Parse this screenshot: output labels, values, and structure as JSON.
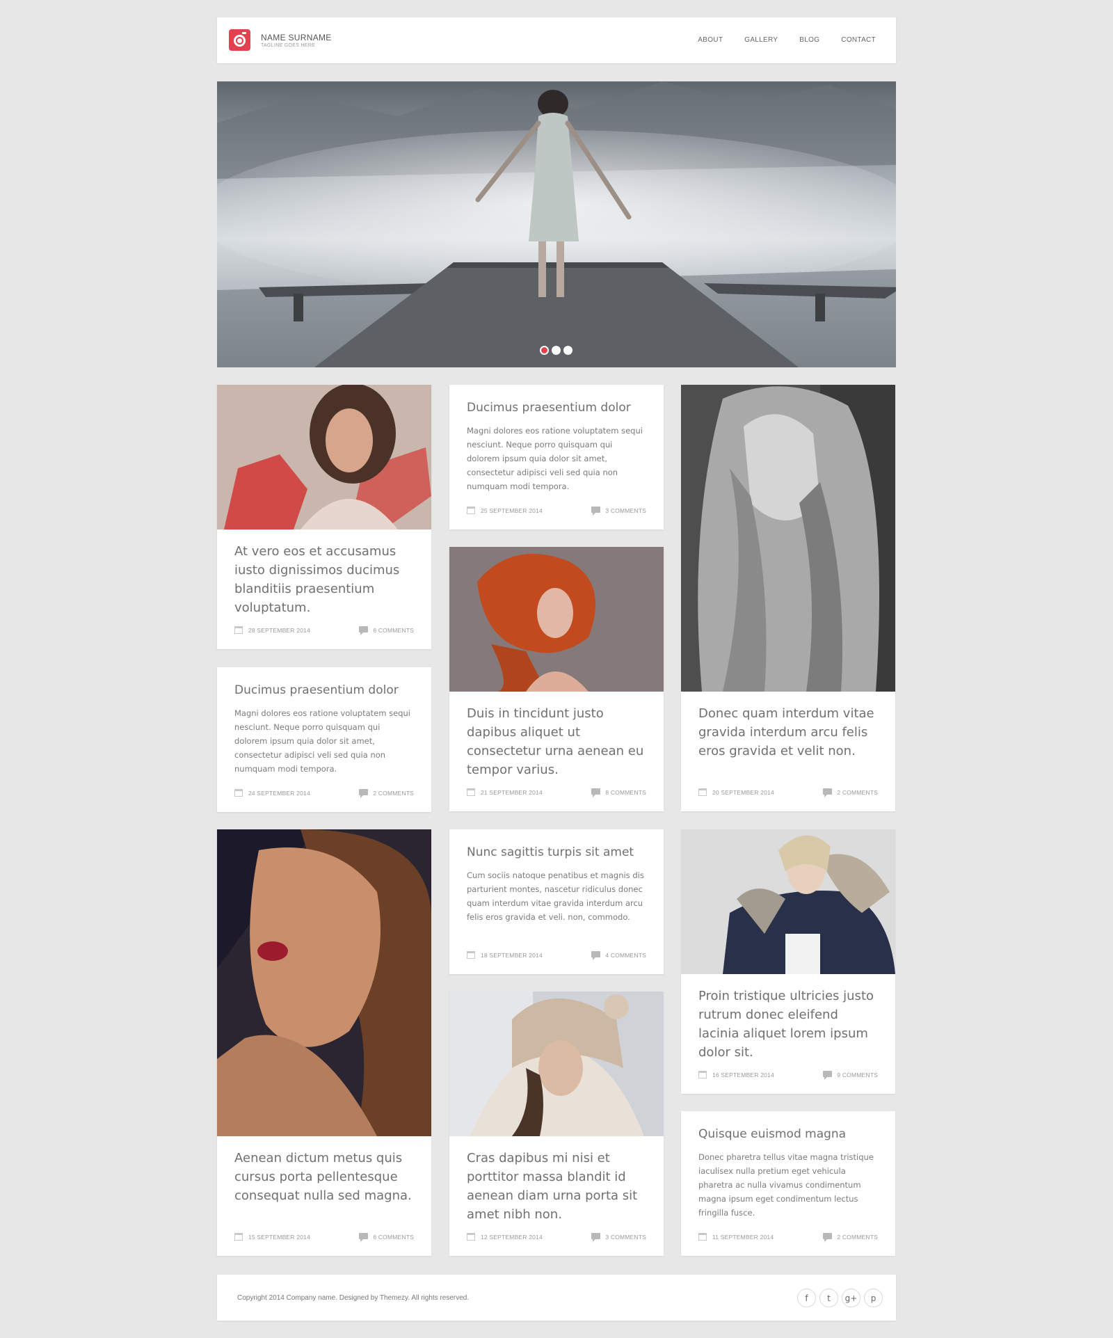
{
  "header": {
    "brand_name": "NAME SURNAME",
    "tagline": "TAGLINE GOES HERE",
    "nav": [
      "ABOUT",
      "GALLERY",
      "BLOG",
      "CONTACT"
    ]
  },
  "hero": {
    "slides": 3,
    "active_slide": 1
  },
  "posts": [
    {
      "title": "At vero eos et accusamus iusto dignissimos ducimus blanditiis praesentium voluptatum.",
      "date": "28 SEPTEMBER 2014",
      "comments": "6 COMMENTS"
    },
    {
      "title": "Ducimus praesentium dolor",
      "excerpt": "Magni dolores eos ratione voluptatem sequi nesciunt. Neque porro quisquam qui dolorem ipsum quia dolor sit amet, consectetur adipisci veli sed quia non numquam modi tempora.",
      "date": "25 SEPTEMBER 2014",
      "comments": "3 COMMENTS"
    },
    {
      "title": "Donec quam interdum vitae gravida interdum arcu felis eros gravida et velit non.",
      "date": "20 SEPTEMBER 2014",
      "comments": "2 COMMENTS"
    },
    {
      "title": "Ducimus praesentium dolor",
      "excerpt": "Magni dolores eos ratione voluptatem sequi nesciunt. Neque porro quisquam qui dolorem ipsum quia dolor sit amet, consectetur adipisci veli sed quia non numquam modi tempora.",
      "date": "24 SEPTEMBER 2014",
      "comments": "2 COMMENTS"
    },
    {
      "title": "Duis in tincidunt justo dapibus aliquet ut consectetur urna aenean eu tempor varius.",
      "date": "21 SEPTEMBER 2014",
      "comments": "8 COMMENTS"
    },
    {
      "title": "Nunc sagittis turpis sit amet",
      "excerpt": "Cum sociis natoque penatibus et magnis dis parturient montes, nascetur ridiculus donec quam interdum vitae gravida interdum arcu felis eros gravida et veli. non, commodo.",
      "date": "18 SEPTEMBER 2014",
      "comments": "4 COMMENTS"
    },
    {
      "title": "Proin tristique ultricies justo rutrum donec eleifend lacinia aliquet lorem ipsum dolor sit.",
      "date": "16 SEPTEMBER 2014",
      "comments": "9 COMMENTS"
    },
    {
      "title": "Aenean dictum metus quis cursus porta pellentesque consequat nulla sed magna.",
      "date": "15 SEPTEMBER 2014",
      "comments": "6 COMMENTS"
    },
    {
      "title": "Cras dapibus mi nisi et porttitor massa blandit id aenean diam urna porta sit amet nibh non.",
      "date": "12 SEPTEMBER 2014",
      "comments": "3 COMMENTS"
    },
    {
      "title": "Quisque euismod magna",
      "excerpt": "Donec pharetra tellus vitae magna tristique iaculisex nulla pretium eget vehicula pharetra ac nulla vivamus condimentum magna ipsum eget condimentum lectus fringilla fusce.",
      "date": "11 SEPTEMBER 2014",
      "comments": "2 COMMENTS"
    }
  ],
  "footer": {
    "copyright": "Copyright 2014 Company name. Designed by Themezy. All rights reserved.",
    "socials": [
      {
        "icon": "facebook-icon",
        "glyph": "f"
      },
      {
        "icon": "twitter-icon",
        "glyph": "t"
      },
      {
        "icon": "google-plus-icon",
        "glyph": "g+"
      },
      {
        "icon": "pinterest-icon",
        "glyph": "p"
      }
    ]
  },
  "colors": {
    "accent": "#e2424f",
    "background": "#e7e7e7",
    "card": "#ffffff"
  }
}
